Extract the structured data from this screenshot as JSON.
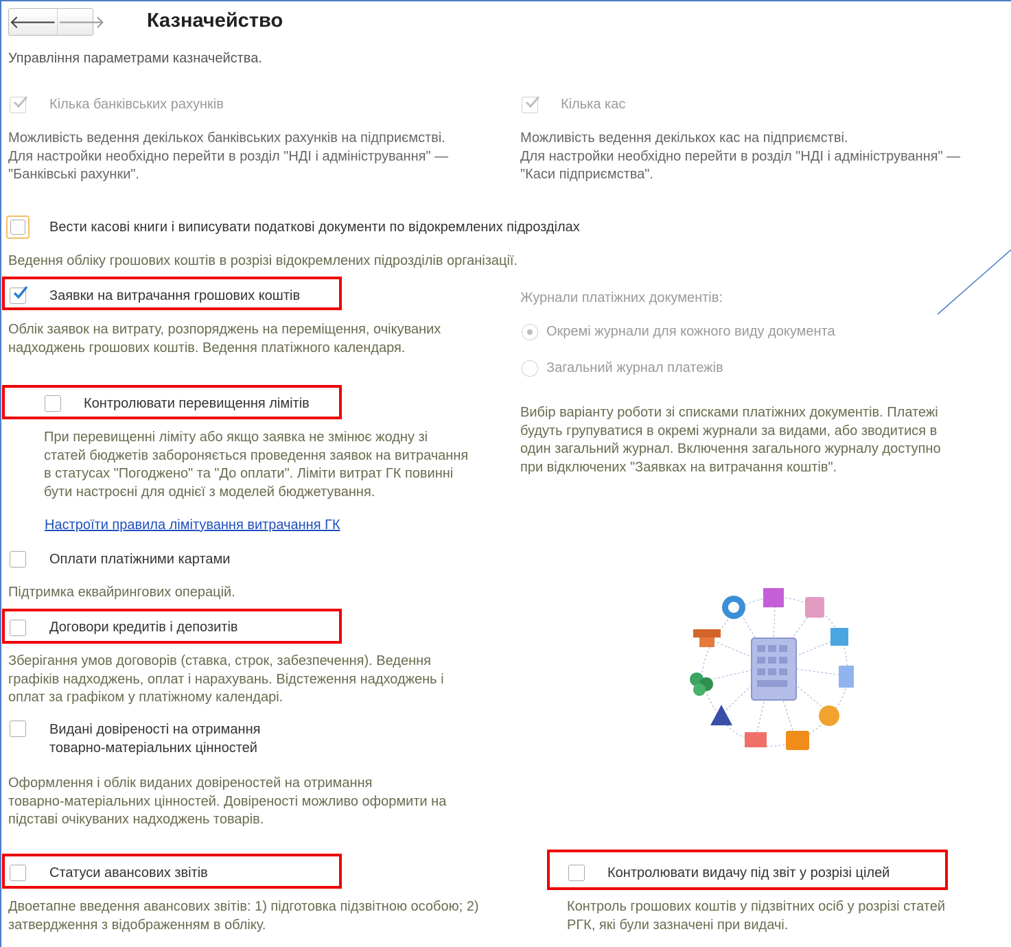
{
  "header": {
    "back_icon": "arrow-left-icon",
    "forward_icon": "arrow-right-icon",
    "title": "Казначейство",
    "subtitle": "Управління параметрами казначейства."
  },
  "multi_bank": {
    "label": "Кілька банківських рахунків",
    "checked": true,
    "disabled": true,
    "desc1": "Можливість ведення декількох банківських рахунків на підприємстві.",
    "desc2": "Для настройки необхідно перейти в розділ \"НДІ і адміністрування\" —",
    "desc3": "\"Банківські рахунки\"."
  },
  "multi_cash": {
    "label": "Кілька кас",
    "checked": true,
    "disabled": true,
    "desc1": "Можливість ведення декількох кас на підприємстві.",
    "desc2": "Для настройки необхідно перейти в розділ \"НДІ і адміністрування\" —",
    "desc3": "\"Каси підприємства\"."
  },
  "cash_books": {
    "label": "Вести касові книги і виписувати податкові документи по відокремлених підрозділах",
    "checked": false,
    "desc": "Ведення обліку грошових коштів в розрізі відокремлених підрозділів організації."
  },
  "requests": {
    "label": "Заявки на витрачання грошових коштів",
    "checked": true,
    "desc1": "Облік заявок на витрату, розпоряджень на переміщення, очікуваних",
    "desc2": "надходжень грошових коштів. Ведення платіжного календаря."
  },
  "journals": {
    "heading": "Журнали платіжних документів:",
    "option1": "Окремі журнали для кожного виду документа",
    "option2": "Загальний журнал платежів",
    "selected": "Окремі журнали для кожного виду документа",
    "desc1": "Вибір варіанту роботи зі списками платіжних документів. Платежі",
    "desc2": "будуть групуватися в окремі журнали за видами, або зводитися в",
    "desc3": "один загальний журнал. Включення загального журналу доступно",
    "desc4": "при відключених \"Заявках на витрачання коштів\"."
  },
  "limits": {
    "label": "Контролювати перевищення лімітів",
    "checked": false,
    "desc1": "При перевищенні ліміту або якщо заявка не змінює жодну зі",
    "desc2": "статей бюджетів забороняється проведення заявок на витрачання",
    "desc3": "в статусах \"Погоджено\" та \"До оплати\". Ліміти витрат ГК повинні",
    "desc4": "бути настроєні для однієї з моделей бюджетування.",
    "link": "Настроїти правила лімітування витрачання ГК"
  },
  "cards": {
    "label": "Оплати платіжними картами",
    "checked": false,
    "desc": "Підтримка еквайрингових операцій."
  },
  "loans": {
    "label": "Договори кредитів і депозитів",
    "checked": false,
    "desc1": "Зберігання умов договорів (ставка, строк, забезпечення). Ведення",
    "desc2": "графіків надходжень, оплат і нарахувань. Відстеження надходжень і",
    "desc3": "оплат за графіком у платіжному календарі."
  },
  "proxies": {
    "label1": "Видані довіреності на отримання",
    "label2": "товарно-матеріальних цінностей",
    "checked": false,
    "desc1": "Оформлення і облік виданих довіреностей на отримання",
    "desc2": "товарно-матеріальних цінностей. Довіреності можливо оформити на",
    "desc3": "підставі очікуваних надходжень товарів."
  },
  "advance": {
    "label": "Статуси авансових звітів",
    "checked": false,
    "desc1": "Двоетапне введення авансових звітів: 1) підготовка підзвітною особою; 2)",
    "desc2": "затвердження з відображенням в обліку."
  },
  "purpose_control": {
    "label": "Контролювати видачу під звіт у розрізі цілей",
    "checked": false,
    "desc1": "Контроль грошових коштів у підзвітних осіб у розрізі статей",
    "desc2": "РГК, які були зазначені при видачі."
  },
  "illustration_icon": "treasury-network-illustration-icon",
  "colors": {
    "highlight": "#ee0000",
    "link": "#1f4fbf",
    "frame": "#4a7ec9",
    "check": "#2a7fd4"
  }
}
